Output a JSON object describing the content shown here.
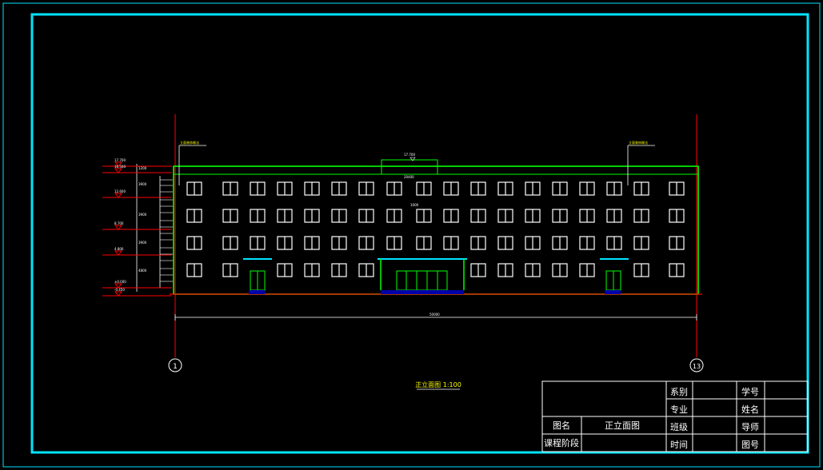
{
  "drawing": {
    "caption": "正立面图 1:100",
    "axis_left": "1",
    "axis_right": "13",
    "overall_dimension": "50000",
    "note_left": "立面装饰做法",
    "note_right": "立面装饰做法",
    "roof_label": "17.700",
    "parapet_label": "20400",
    "detail_label": "1000",
    "elevations": [
      "17.700",
      "16.500",
      "12.600",
      "8.700",
      "4.800",
      "±0.000",
      "-0.450"
    ],
    "floor_dims": [
      "1200",
      "3900",
      "3900",
      "3900",
      "4800"
    ]
  },
  "title_block": {
    "labels": {
      "dept": "系别",
      "major": "专业",
      "class": "班级",
      "time": "时间",
      "student_no": "学号",
      "name": "姓名",
      "advisor": "导师",
      "drawing_no": "图号",
      "drawing_name": "图名",
      "drawing_name_value": "正立面图",
      "course_stage": "课程阶段"
    }
  },
  "colors": {
    "frame": "#00e5ff",
    "building": "#00ff00",
    "ground": "#ff0000",
    "windows": "#ffffff",
    "door_base": "#0000aa",
    "canopy": "#00e5ff",
    "title_block": "#ffffff"
  }
}
